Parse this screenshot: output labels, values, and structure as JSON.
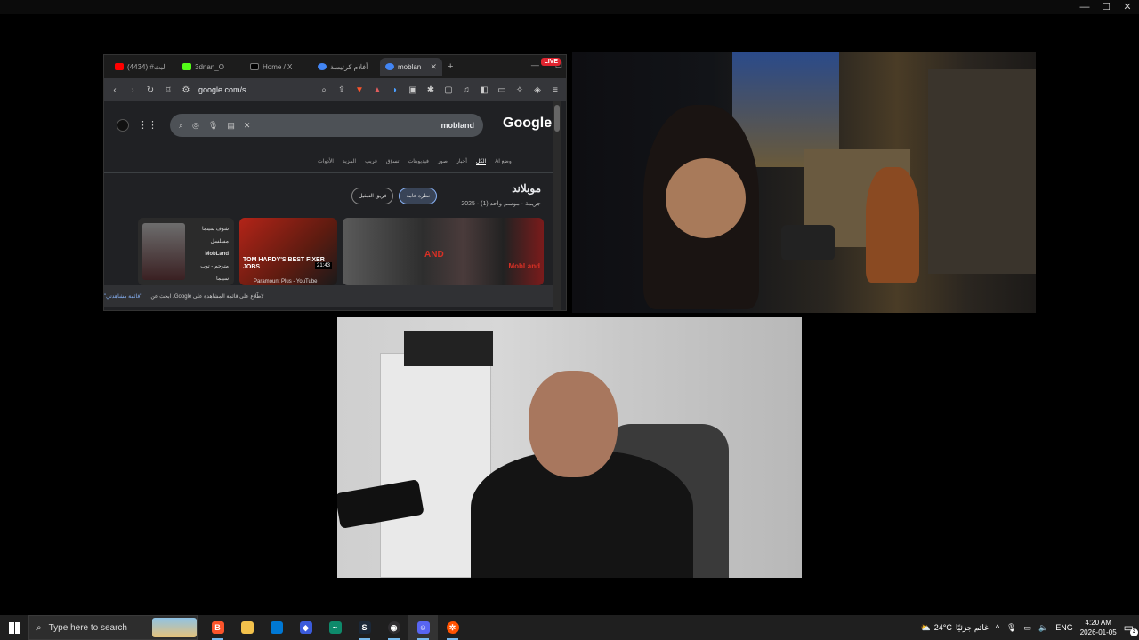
{
  "window": {
    "controls": [
      "—",
      "☐",
      "✕"
    ]
  },
  "browser": {
    "tabs": [
      {
        "label": "(4434) #البث",
        "favicon_color": "#ff0000"
      },
      {
        "label": "3dnan_O",
        "favicon_color": "#53fc18"
      },
      {
        "label": "Home / X",
        "favicon_color": "#000000"
      },
      {
        "label": "أفلام كرتيسة",
        "favicon_color": "#4285f4"
      },
      {
        "label": "moblan",
        "favicon_color": "#4285f4",
        "active": true
      }
    ],
    "live_badge": "LIVE",
    "url": "google.com/s...",
    "search": {
      "query": "mobland",
      "logo": "Google",
      "nav_tabs": [
        "وضع AI",
        "الكل",
        "أخبار",
        "صور",
        "فيديوهات",
        "تسوّق",
        "قريب",
        "المزيد",
        "الأدوات"
      ],
      "selected_tab": "الكل"
    },
    "knowledge_panel": {
      "title": "موبلاند",
      "subtitle": "2025 · جريمة · موسم واحد (1)",
      "buttons": [
        "نظرة عامة",
        "فريق التمثيل"
      ],
      "card1_lines": [
        "شوف سينما",
        "مسلسل",
        "MobLand",
        "مترجم - توب",
        "سينما"
      ],
      "card2_caption": "TOM HARDY'S BEST FIXER JOBS",
      "card2_duration": "21:43",
      "card2_source": "Paramount Plus - YouTube",
      "card3_text_left": "AND",
      "card3_text_right": "MobLand"
    },
    "footer": {
      "text": "لاطّلاع على قائمة المشاهدة على Google، ابحث عن",
      "link": "\"قائمة مشاهدتي\""
    }
  },
  "taskbar": {
    "search_placeholder": "Type here to search",
    "apps": [
      {
        "name": "brave",
        "glyph": "🦁",
        "color": "#fb542b"
      },
      {
        "name": "file-explorer",
        "glyph": "📁",
        "color": "#f3c24c"
      },
      {
        "name": "store",
        "glyph": "■",
        "color": "#0078d4"
      },
      {
        "name": "app-blue",
        "glyph": "◆",
        "color": "#3b5bdb"
      },
      {
        "name": "terminal-app",
        "glyph": "~",
        "color": "#0e8a6b"
      },
      {
        "name": "steam",
        "glyph": "♨",
        "color": "#1b2838"
      },
      {
        "name": "obs",
        "glyph": "◉",
        "color": "#302e31"
      },
      {
        "name": "discord",
        "glyph": "☺",
        "color": "#5865f2"
      },
      {
        "name": "steelseries",
        "glyph": "✲",
        "color": "#ff5200"
      }
    ],
    "weather_temp": "24°C",
    "weather_text": "غائم جزئيًا",
    "language": "ENG",
    "time": "4:20 AM",
    "date": "2026-01-05",
    "notifications": "3"
  }
}
